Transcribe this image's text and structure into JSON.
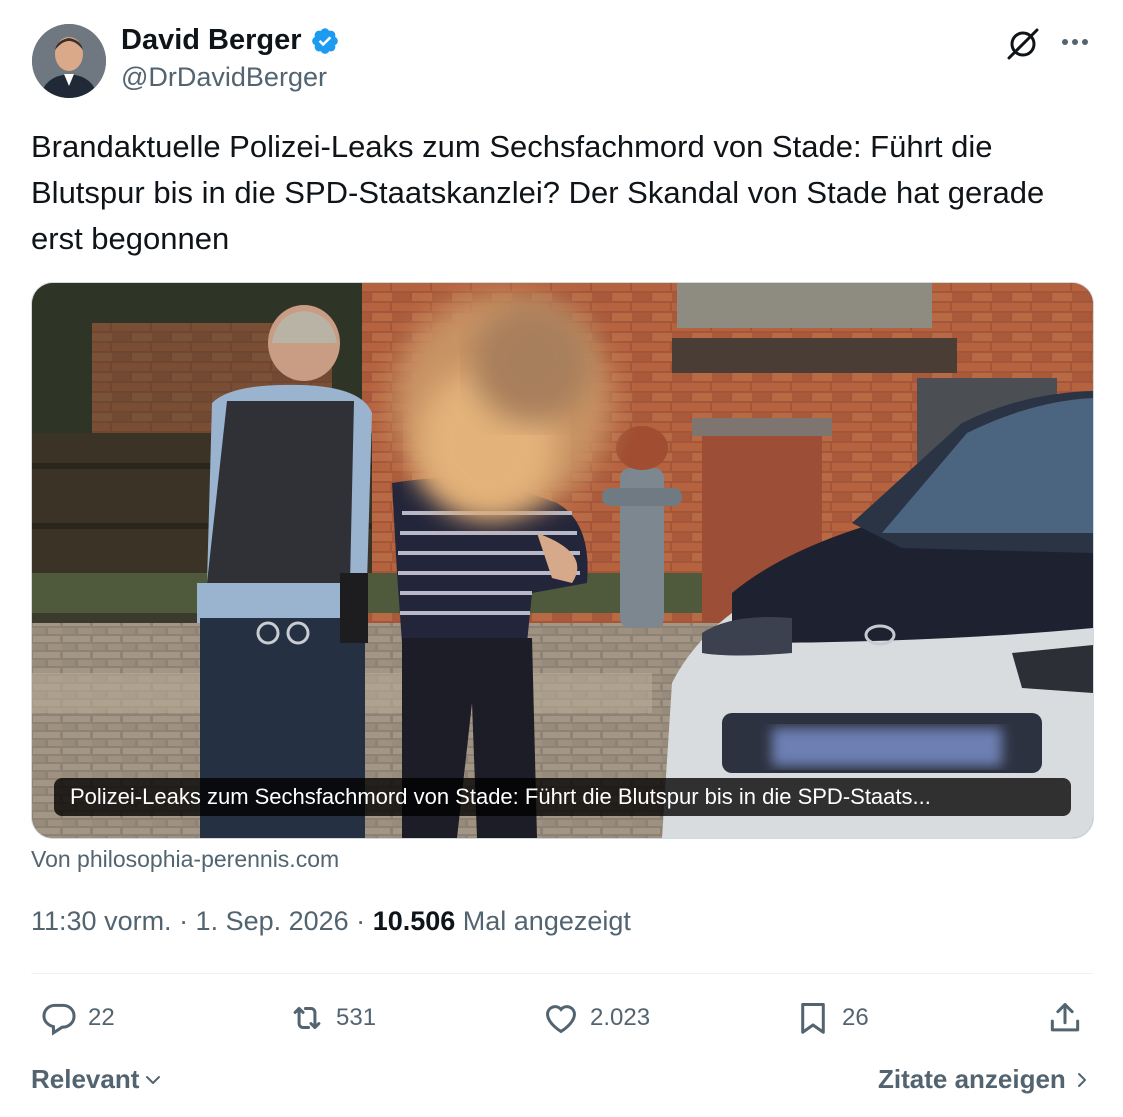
{
  "author": {
    "name": "David Berger",
    "handle": "@DrDavidBerger",
    "verified": true,
    "verified_color": "#1d9bf0"
  },
  "icons": {
    "grok": "grok-icon",
    "more": "more-options-icon",
    "verified": "verified-badge-icon"
  },
  "tweet": {
    "text": "Brandaktuelle Polizei-Leaks zum Sechsfachmord von Stade: Führt die Blutspur bis in die SPD-Staatskanzlei? Der Skandal von Stade hat gerade erst begonnen"
  },
  "media": {
    "caption": "Polizei-Leaks zum Sechsfachmord von Stade: Führt die Blutspur bis in die SPD-Staats...",
    "source": "Von philosophia-perennis.com"
  },
  "meta": {
    "time": "11:30 vorm. · 1. Sep. 2026 · ",
    "views_count": "10.506",
    "views_label": " Mal angezeigt"
  },
  "actions": {
    "replies": "22",
    "reposts": "531",
    "likes": "2.023",
    "bookmarks": "26"
  },
  "footer": {
    "sort_label": "Relevant",
    "quotes_label": "Zitate anzeigen"
  }
}
